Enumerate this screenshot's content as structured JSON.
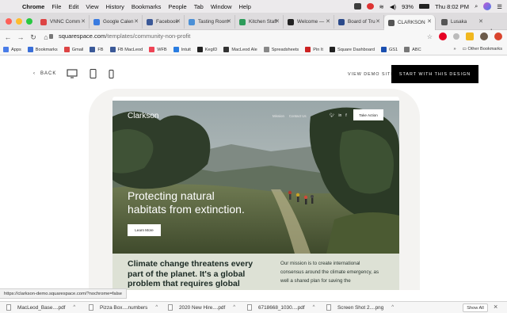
{
  "menubar": {
    "app": "Chrome",
    "items": [
      "File",
      "Edit",
      "View",
      "History",
      "Bookmarks",
      "People",
      "Tab",
      "Window",
      "Help"
    ],
    "battery": "93%",
    "clock": "Thu 8:02 PM"
  },
  "tabs": [
    {
      "title": "VNNC Comm",
      "color": "#d44"
    },
    {
      "title": "Google Calen",
      "color": "#3a7be0"
    },
    {
      "title": "Facebook",
      "color": "#3b5998"
    },
    {
      "title": "Tasting Room",
      "color": "#4a8fd6"
    },
    {
      "title": "Kitchen Staff",
      "color": "#2d9b5a"
    },
    {
      "title": "Welcome — ",
      "color": "#222"
    },
    {
      "title": "Board of Tru",
      "color": "#2b4a8a"
    },
    {
      "title": "CLARKSON",
      "color": "#555"
    },
    {
      "title": "Lusaka",
      "color": "#555"
    }
  ],
  "active_tab": 7,
  "toolbar": {
    "url_domain": "squarespace.com",
    "url_path": "/templates/community-non-profit"
  },
  "bookmarks": {
    "items": [
      {
        "label": "Apps",
        "color": "#4a7de8"
      },
      {
        "label": "Bookmarks",
        "color": "#3a6fd8"
      },
      {
        "label": "Gmail",
        "color": "#d44"
      },
      {
        "label": "FB",
        "color": "#3b5998"
      },
      {
        "label": "FB MacLeod",
        "color": "#3b5998"
      },
      {
        "label": "WFB",
        "color": "#e45"
      },
      {
        "label": "Intuit",
        "color": "#2a7de1"
      },
      {
        "label": "KegID",
        "color": "#222"
      },
      {
        "label": "MacLeod Ale",
        "color": "#333"
      },
      {
        "label": "Spreadsheets",
        "color": "#888"
      },
      {
        "label": "Pin It",
        "color": "#c22"
      },
      {
        "label": "Square Dashboard",
        "color": "#222"
      },
      {
        "label": "GS1",
        "color": "#1a4fb0"
      },
      {
        "label": "ABC",
        "color": "#777"
      }
    ],
    "more": "»",
    "other": "Other Bookmarks"
  },
  "preview": {
    "back_label": "BACK",
    "view_demo": "VIEW DEMO SITE",
    "start_label": "START WITH THIS DESIGN"
  },
  "site": {
    "logo": "Clarkson",
    "nav": [
      "Mission",
      "Contact Us"
    ],
    "take_action": "Take Action",
    "hero_heading": "Protecting natural habitats from extinction.",
    "learn_more": "Learn More",
    "lower_heading": "Climate change threatens every part of the planet. It's a global problem that requires global",
    "lower_paragraph": "Our mission is to create international consensus around the climate emergency, as well a shared plan for saving the"
  },
  "status_url": "https://clarkson-demo.squarespace.com/?nochrome=false",
  "downloads": [
    {
      "name": "MacLeod_Base....pdf"
    },
    {
      "name": "Pizza Box....numbers"
    },
    {
      "name": "2020 New Hire....pdf"
    },
    {
      "name": "6718668_1030....pdf"
    },
    {
      "name": "Screen Shot 2....png"
    }
  ],
  "show_all": "Show All"
}
